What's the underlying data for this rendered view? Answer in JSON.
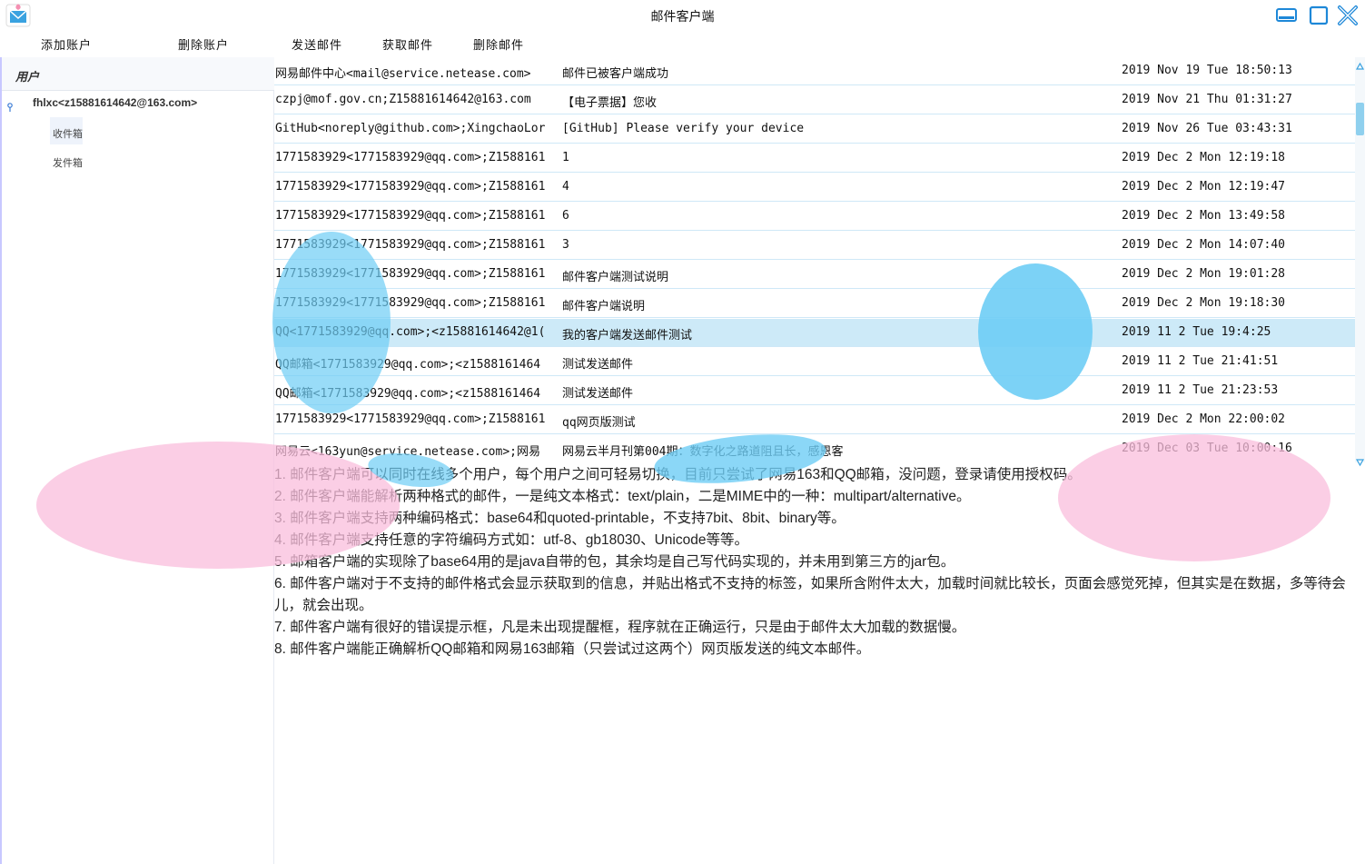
{
  "window": {
    "title": "邮件客户端",
    "icons": {
      "app": "mail-envelope-icon",
      "minimize": "minimize-icon",
      "maximize": "maximize-icon",
      "close": "close-icon"
    },
    "accent": "#1e88d8"
  },
  "menu": {
    "add_account": "添加账户",
    "delete_account": "删除账户",
    "send_mail": "发送邮件",
    "fetch_mail": "获取邮件",
    "delete_mail": "删除邮件"
  },
  "sidebar": {
    "header": "用户",
    "account": "fhlxc<z15881614642@163.com>",
    "folders": [
      "收件箱",
      "发件箱"
    ]
  },
  "mails": [
    {
      "from": "网易邮件中心<mail@service.netease.com>",
      "subject": "邮件已被客户端成功",
      "date": "2019 Nov 19 Tue 18:50:13"
    },
    {
      "from": "czpj@mof.gov.cn;Z15881614642@163.com",
      "subject": "【电子票据】您收",
      "date": "2019 Nov 21 Thu 01:31:27"
    },
    {
      "from": "GitHub<noreply@github.com>;XingchaoLor",
      "subject": "[GitHub] Please verify your device",
      "date": "2019 Nov 26 Tue 03:43:31"
    },
    {
      "from": "1771583929<1771583929@qq.com>;Z1588161",
      "subject": "1",
      "date": "2019 Dec 2 Mon 12:19:18"
    },
    {
      "from": "1771583929<1771583929@qq.com>;Z1588161",
      "subject": "4",
      "date": "2019 Dec 2 Mon 12:19:47"
    },
    {
      "from": "1771583929<1771583929@qq.com>;Z1588161",
      "subject": "6",
      "date": "2019 Dec 2 Mon 13:49:58"
    },
    {
      "from": "1771583929<1771583929@qq.com>;Z1588161",
      "subject": "3",
      "date": "2019 Dec 2 Mon 14:07:40"
    },
    {
      "from": "1771583929<1771583929@qq.com>;Z1588161",
      "subject": "邮件客户端测试说明",
      "date": "2019 Dec 2 Mon 19:01:28"
    },
    {
      "from": "1771583929<1771583929@qq.com>;Z1588161",
      "subject": "邮件客户端说明",
      "date": "2019 Dec 2 Mon 19:18:30"
    },
    {
      "from": "QQ<1771583929@qq.com>;<z15881614642@1(",
      "subject": "我的客户端发送邮件测试",
      "date": "2019 11 2 Tue 19:4:25"
    },
    {
      "from": "QQ邮箱<1771583929@qq.com>;<z1588161464",
      "subject": "测试发送邮件",
      "date": "2019 11 2 Tue 21:41:51"
    },
    {
      "from": "QQ邮箱<1771583929@qq.com>;<z1588161464",
      "subject": "测试发送邮件",
      "date": "2019 11 2 Tue 21:23:53"
    },
    {
      "from": "1771583929<1771583929@qq.com>;Z1588161",
      "subject": "qq网页版测试",
      "date": "2019 Dec 2 Mon 22:00:02"
    },
    {
      "from": "网易云<163yun@service.netease.com>;网易",
      "subject": "网易云半月刊第004期：数字化之路道阻且长，感恩客",
      "date": "2019 Dec 03 Tue 10:00:16"
    }
  ],
  "selected_mail_index": 9,
  "content": [
    "1. 邮件客户端可以同时在线多个用户，每个用户之间可轻易切换，目前只尝试了网易163和QQ邮箱，没问题，登录请使用授权码。",
    "2. 邮件客户端能解析两种格式的邮件，一是纯文本格式：text/plain，二是MIME中的一种：multipart/alternative。",
    "3. 邮件客户端支持两种编码格式：base64和quoted-printable，不支持7bit、8bit、binary等。",
    "4. 邮件客户端支持任意的字符编码方式如：utf-8、gb18030、Unicode等等。",
    "5. 邮箱客户端的实现除了base64用的是java自带的包，其余均是自己写代码实现的，并未用到第三方的jar包。",
    "6. 邮件客户端对于不支持的邮件格式会显示获取到的信息，并贴出格式不支持的标签，如果所含附件太大，加载时间就比较长，页面会感觉死掉，但其实是在数据，多等待会儿，就会出现。",
    "7. 邮件客户端有很好的错误提示框，凡是未出现提醒框，程序就在正确运行，只是由于邮件太大加载的数据慢。",
    "8. 邮件客户端能正确解析QQ邮箱和网易163邮箱（只尝试过这两个）网页版发送的纯文本邮件。"
  ]
}
